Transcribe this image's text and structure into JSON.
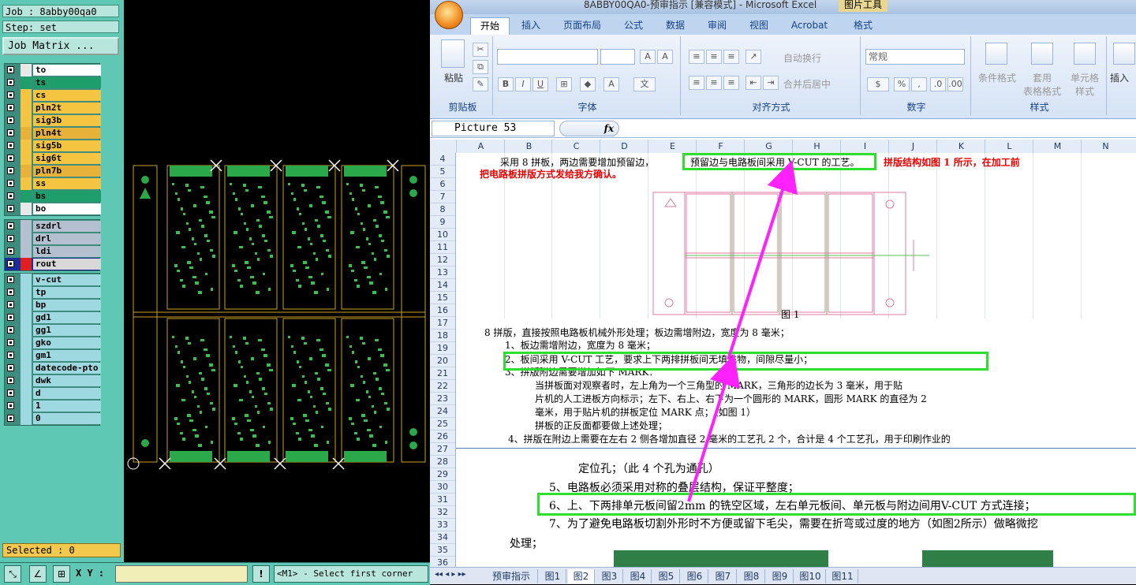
{
  "cam": {
    "job": "Job : 8abby00qa0",
    "step": "Step: set",
    "job_matrix": "Job Matrix ...",
    "layer_groups": [
      {
        "layers": [
          {
            "name": "to",
            "color": "#ffffff",
            "sw": "#e8e8e8"
          },
          {
            "name": "ts",
            "color": "#1e9e6a",
            "sw": "#1e9e6a"
          },
          {
            "name": "cs",
            "color": "#f5c542",
            "sw": "#f5c542"
          },
          {
            "name": "pln2t",
            "color": "#f5c542",
            "sw": "#f5c542"
          },
          {
            "name": "sig3b",
            "color": "#f5c542",
            "sw": "#f5c542"
          },
          {
            "name": "pln4t",
            "color": "#e8b23a",
            "sw": "#e8b23a"
          },
          {
            "name": "sig5b",
            "color": "#f5c542",
            "sw": "#f5c542"
          },
          {
            "name": "sig6t",
            "color": "#f5c542",
            "sw": "#f5c542"
          },
          {
            "name": "pln7b",
            "color": "#e8b23a",
            "sw": "#e8b23a"
          },
          {
            "name": "ss",
            "color": "#f5c542",
            "sw": "#f5c542"
          },
          {
            "name": "bs",
            "color": "#1e9e6a",
            "sw": "#1e9e6a"
          },
          {
            "name": "bo",
            "color": "#ffffff",
            "sw": "#e8e8e8"
          }
        ]
      },
      {
        "layers": [
          {
            "name": "szdrl",
            "color": "#b4c0d0",
            "sw": "#b4c0d0"
          },
          {
            "name": "drl",
            "color": "#b4c0d0",
            "sw": "#b4c0d0"
          },
          {
            "name": "ldi",
            "color": "#b4c0d0",
            "sw": "#b4c0d0"
          },
          {
            "name": "rout",
            "color": "#d8d8d8",
            "sw": "#e02020",
            "active": true
          }
        ]
      },
      {
        "layers": [
          {
            "name": "v-cut",
            "color": "#9ed8e0",
            "sw": "#9ed8e0"
          },
          {
            "name": "tp",
            "color": "#9ed8e0",
            "sw": "#9ed8e0"
          },
          {
            "name": "bp",
            "color": "#9ed8e0",
            "sw": "#9ed8e0"
          },
          {
            "name": "gd1",
            "color": "#9ed8e0",
            "sw": "#9ed8e0"
          },
          {
            "name": "gg1",
            "color": "#9ed8e0",
            "sw": "#9ed8e0"
          },
          {
            "name": "gko",
            "color": "#9ed8e0",
            "sw": "#9ed8e0"
          },
          {
            "name": "gm1",
            "color": "#9ed8e0",
            "sw": "#9ed8e0"
          },
          {
            "name": "datecode-pto",
            "color": "#9ed8e0",
            "sw": "#9ed8e0"
          },
          {
            "name": "dwk",
            "color": "#9ed8e0",
            "sw": "#9ed8e0"
          },
          {
            "name": "d",
            "color": "#9ed8e0",
            "sw": "#9ed8e0"
          },
          {
            "name": "1",
            "color": "#9ed8e0",
            "sw": "#9ed8e0"
          },
          {
            "name": "0",
            "color": "#9ed8e0",
            "sw": "#9ed8e0"
          }
        ]
      }
    ],
    "selected": "Selected : 0",
    "xy_label": "X Y :",
    "status_msg": "<M1> - Select first corner",
    "alert_glyph": "!"
  },
  "excel": {
    "title": "8ABBY00QA0-预审指示 [兼容模式] - Microsoft Excel",
    "context_tab": "图片工具",
    "tabs": [
      "开始",
      "插入",
      "页面布局",
      "公式",
      "数据",
      "审阅",
      "视图",
      "Acrobat",
      "格式"
    ],
    "ribbon": {
      "paste": "粘贴",
      "clipboard": "剪贴板",
      "font": "字体",
      "alignment": "对齐方式",
      "number": "数字",
      "styles": "样式",
      "wrap": "自动换行",
      "merge": "合并后居中",
      "number_format": "常规",
      "cond_format": "条件格式",
      "table_format_1": "套用",
      "table_format_2": "表格格式",
      "cell_style_1": "单元格",
      "cell_style_2": "样式",
      "insert": "插入"
    },
    "name_box": "Picture 53",
    "fx": "fx",
    "columns": [
      "A",
      "B",
      "C",
      "D",
      "E",
      "F",
      "G",
      "H",
      "I",
      "J",
      "K",
      "L",
      "M",
      "N"
    ],
    "rows": [
      "4",
      "5",
      "6",
      "7",
      "8",
      "9",
      "10",
      "11",
      "12",
      "13",
      "14",
      "15",
      "16",
      "17",
      "18",
      "19",
      "20",
      "21",
      "22",
      "23",
      "24",
      "25",
      "26",
      "27",
      "28",
      "29",
      "30",
      "31",
      "32",
      "33",
      "34",
      "35",
      "36"
    ],
    "text": {
      "r4a": "采用 8 拼板，两边需要增加预留边，",
      "r4b": "预留边与电路板间采用 V-CUT 的工艺。",
      "r4c": "拼版结构如图 1 所示，在加工前",
      "r5": "把电路板拼版方式发给我方确认。",
      "fig1": "图 1",
      "r18": "8 拼版，直接按照电路板机械外形处理；板边需增附边，宽度为 8 毫米；",
      "r19": "1、板边需增附边，宽度为 8 毫米；",
      "r20": "2、板间采用 V-CUT 工艺，要求上下两排拼板间无填充物，间隙尽量小；",
      "r21": "3、拼版附边需要增加如下 MARK：",
      "r22": "当拼板面对观察者时，左上角为一个三角型的 MARK，三角形的边长为 3 毫米，用于贴",
      "r23": "片机的人工进板方向标示；左下、右上、右下为一个圆形的 MARK，圆形 MARK 的直径为 2",
      "r24": "毫米，用于贴片机的拼板定位 MARK 点；（如图 1）",
      "r25": "拼板的正反面都要做上述处理；",
      "r26": "4、拼版在附边上需要在左右 2 侧各增加直径 2 毫米的工艺孔 2 个，合计是 4 个工艺孔，用于印刷作业的",
      "r29": "定位孔；（此 4 个孔为通孔）",
      "r30": "5、电路板必须采用对称的叠层结构，保证平整度；",
      "r31": "6、上、下两排单元板间留2mm 的铣空区域，左右单元板间、单元板与附边间用V-CUT 方式连接；",
      "r33": "7、为了避免电路板切割外形时不方便或留下毛尖，需要在折弯或过度的地方（如图2所示）做略微挖",
      "r34": "处理；"
    },
    "sheet_tabs": [
      "预审指示",
      "图1",
      "图2",
      "图3",
      "图4",
      "图5",
      "图6",
      "图7",
      "图8",
      "图9",
      "图10",
      "图11"
    ],
    "active_sheet": "图2"
  }
}
